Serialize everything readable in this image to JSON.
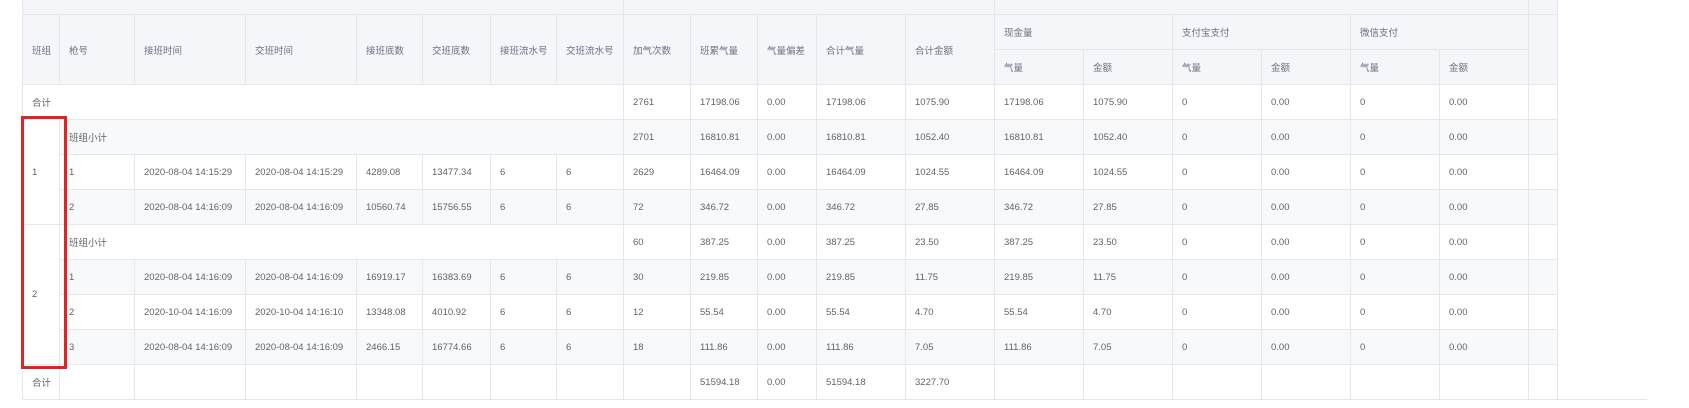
{
  "table": {
    "headers": {
      "shift": "班组",
      "gun_no": "枪号",
      "start_time": "接班时间",
      "end_time": "交班时间",
      "start_reading": "接班底数",
      "end_reading": "交班底数",
      "start_serial": "接班流水号",
      "end_serial": "交班流水号",
      "fill_count": "加气次数",
      "meter_gas": "班累气量",
      "gas_diff": "气量偏差",
      "total_gas": "合计气量",
      "total_amount": "合计金额",
      "cash": "现金量",
      "alipay": "支付宝支付",
      "wechat": "微信支付",
      "sub_gas": "气量",
      "sub_amount": "金额"
    },
    "grand_total": {
      "label": "合计",
      "values": [
        "2761",
        "17198.06",
        "0.00",
        "17198.06",
        "1075.90",
        "17198.06",
        "1075.90",
        "0",
        "0.00",
        "0",
        "0.00"
      ]
    },
    "groups": [
      {
        "shift": "1",
        "subtotal": {
          "label": "班组小计",
          "values": [
            "2701",
            "16810.81",
            "0.00",
            "16810.81",
            "1052.40",
            "16810.81",
            "1052.40",
            "0",
            "0.00",
            "0",
            "0.00"
          ]
        },
        "rows": [
          [
            "1",
            "2020-08-04 14:15:29",
            "2020-08-04 14:15:29",
            "4289.08",
            "13477.34",
            "6",
            "6",
            "2629",
            "16464.09",
            "0.00",
            "16464.09",
            "1024.55",
            "16464.09",
            "1024.55",
            "0",
            "0.00",
            "0",
            "0.00"
          ],
          [
            "2",
            "2020-08-04 14:16:09",
            "2020-08-04 14:16:09",
            "10560.74",
            "15756.55",
            "6",
            "6",
            "72",
            "346.72",
            "0.00",
            "346.72",
            "27.85",
            "346.72",
            "27.85",
            "0",
            "0.00",
            "0",
            "0.00"
          ]
        ]
      },
      {
        "shift": "2",
        "subtotal": {
          "label": "班组小计",
          "values": [
            "60",
            "387.25",
            "0.00",
            "387.25",
            "23.50",
            "387.25",
            "23.50",
            "0",
            "0.00",
            "0",
            "0.00"
          ]
        },
        "rows": [
          [
            "1",
            "2020-08-04 14:16:09",
            "2020-08-04 14:16:09",
            "16919.17",
            "16383.69",
            "6",
            "6",
            "30",
            "219.85",
            "0.00",
            "219.85",
            "11.75",
            "219.85",
            "11.75",
            "0",
            "0.00",
            "0",
            "0.00"
          ],
          [
            "2",
            "2020-10-04 14:16:09",
            "2020-10-04 14:16:10",
            "13348.08",
            "4010.92",
            "6",
            "6",
            "12",
            "55.54",
            "0.00",
            "55.54",
            "4.70",
            "55.54",
            "4.70",
            "0",
            "0.00",
            "0",
            "0.00"
          ],
          [
            "3",
            "2020-08-04 14:16:09",
            "2020-08-04 14:16:09",
            "2466.15",
            "16774.66",
            "6",
            "6",
            "18",
            "111.86",
            "0.00",
            "111.86",
            "7.05",
            "111.86",
            "7.05",
            "0",
            "0.00",
            "0",
            "0.00"
          ]
        ]
      }
    ],
    "footer_total": {
      "label": "合计",
      "values": [
        "51594.18",
        "0.00",
        "51594.18",
        "3227.70"
      ]
    }
  }
}
